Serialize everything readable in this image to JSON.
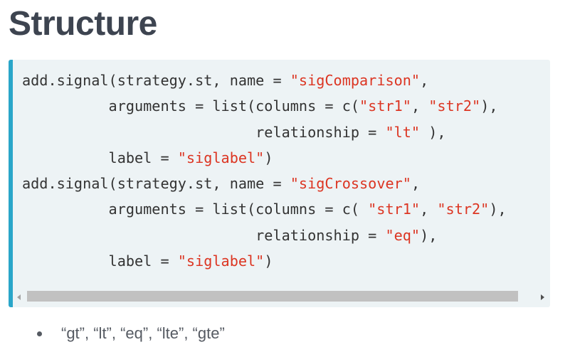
{
  "page": {
    "title": "Structure"
  },
  "code": {
    "lines": [
      [
        {
          "t": "add.signal(strategy.st, name = "
        },
        {
          "t": "\"sigComparison\"",
          "s": true
        },
        {
          "t": ","
        }
      ],
      [
        {
          "t": "          arguments = list(columns = c("
        },
        {
          "t": "\"str1\"",
          "s": true
        },
        {
          "t": ", "
        },
        {
          "t": "\"str2\"",
          "s": true
        },
        {
          "t": "),"
        }
      ],
      [
        {
          "t": "                           relationship = "
        },
        {
          "t": "\"lt\"",
          "s": true
        },
        {
          "t": " ),"
        }
      ],
      [
        {
          "t": "          label = "
        },
        {
          "t": "\"siglabel\"",
          "s": true
        },
        {
          "t": ")"
        }
      ],
      [
        {
          "t": "add.signal(strategy.st, name = "
        },
        {
          "t": "\"sigCrossover\"",
          "s": true
        },
        {
          "t": ","
        }
      ],
      [
        {
          "t": "          arguments = list(columns = c( "
        },
        {
          "t": "\"str1\"",
          "s": true
        },
        {
          "t": ", "
        },
        {
          "t": "\"str2\"",
          "s": true
        },
        {
          "t": "),"
        }
      ],
      [
        {
          "t": "                           relationship = "
        },
        {
          "t": "\"eq\"",
          "s": true
        },
        {
          "t": "),"
        }
      ],
      [
        {
          "t": "          label = "
        },
        {
          "t": "\"siglabel\"",
          "s": true
        },
        {
          "t": ")"
        }
      ]
    ]
  },
  "bullets": [
    "“gt”, “lt”, “eq”, “lte”, “gte”"
  ],
  "colors": {
    "heading": "#3d4450",
    "code_background": "#edf3f5",
    "code_accent_border": "#2aa6c9",
    "string_literal": "#dc3522",
    "code_text": "#333333"
  },
  "icons": {
    "scroll_left": "left-arrow-icon",
    "scroll_right": "right-arrow-icon",
    "bullet": "bullet-dot-icon"
  }
}
